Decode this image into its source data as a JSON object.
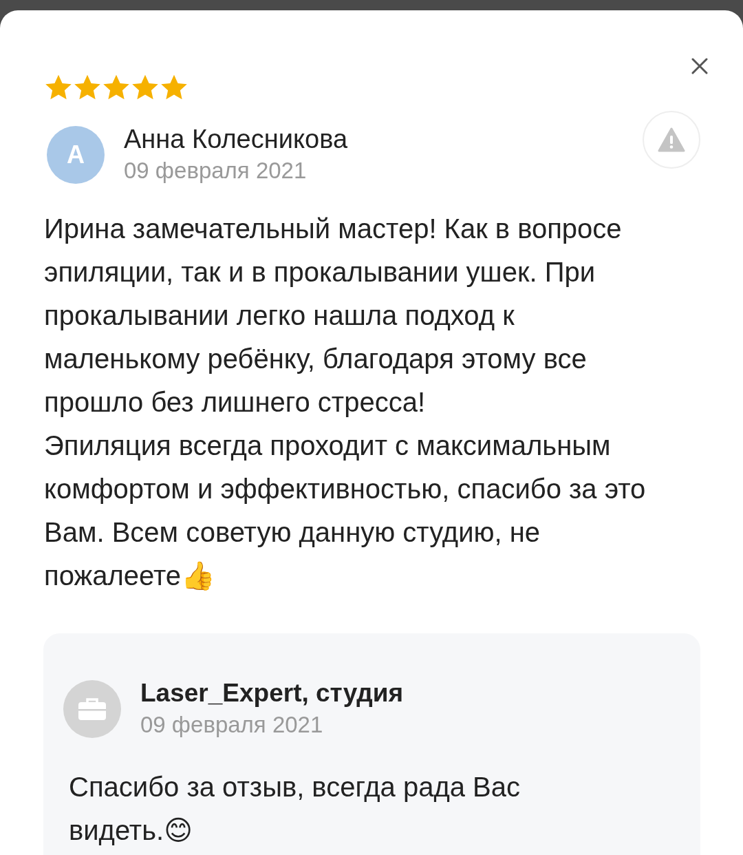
{
  "review": {
    "stars": 5,
    "author": {
      "avatar_letter": "А",
      "name": "Анна Колесникова",
      "date": "09 февраля 2021"
    },
    "paragraphs": [
      "Ирина замечательный мастер! Как в вопросе эпиляции, так и в прокалывании ушек. При прокалывании легко нашла подход к маленькому ребёнку, благодаря этому все прошло без лишнего стресса!",
      "Эпиляция всегда проходит с максимальным комфортом и эффективностью, спасибо за это Вам. Всем советую данную студию, не пожалеете👍"
    ],
    "reply": {
      "name": "Laser_Expert, студия",
      "date": "09 февраля 2021",
      "text": "Спасибо за отзыв, всегда рада Вас видеть.😊"
    }
  }
}
